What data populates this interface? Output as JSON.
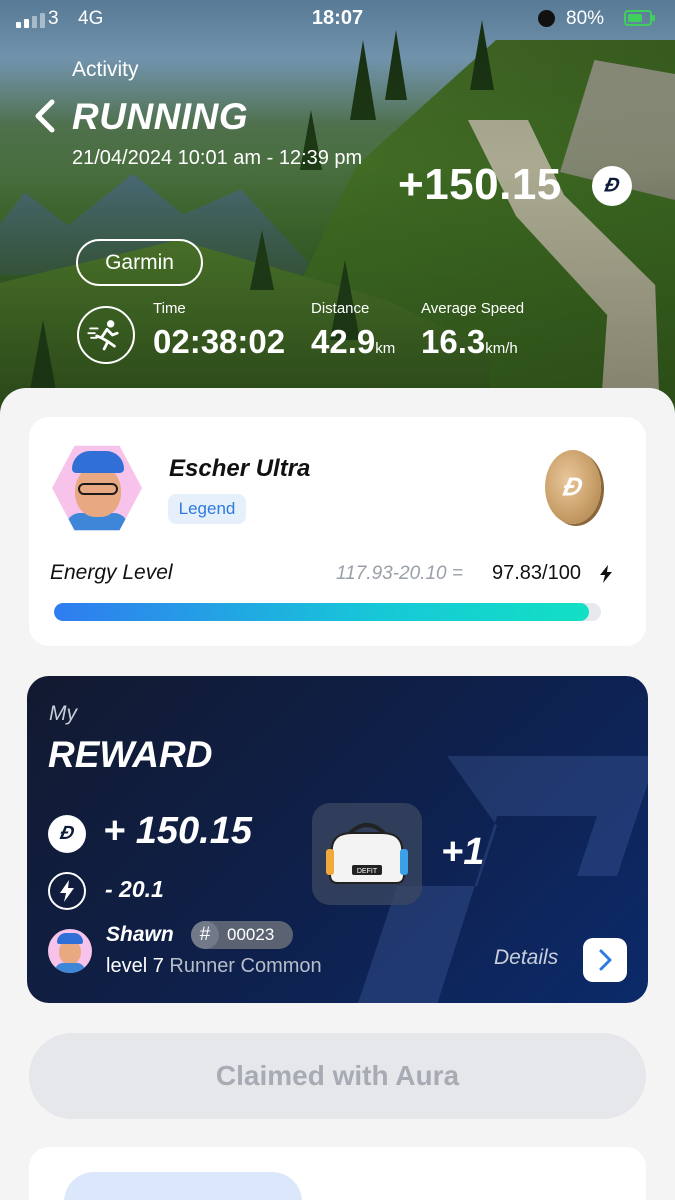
{
  "status_bar": {
    "carrier": "3",
    "network": "4G",
    "time": "18:07",
    "battery": "80%"
  },
  "header": {
    "eyebrow": "Activity",
    "title": "RUNNING",
    "date_range": "21/04/2024 10:01 am - 12:39 pm",
    "earned": "+150.15",
    "device": "Garmin"
  },
  "stats": [
    {
      "label": "Time",
      "value": "02:38:02",
      "unit": ""
    },
    {
      "label": "Distance",
      "value": "42.9",
      "unit": "km"
    },
    {
      "label": "Average Speed",
      "value": "16.3",
      "unit": "km/h"
    }
  ],
  "profile": {
    "name": "Escher Ultra",
    "tier": "Legend",
    "energy_label": "Energy Level",
    "energy_calc": "117.93-20.10 =",
    "energy_value": "97.83/100",
    "energy_fraction": 0.9783
  },
  "reward": {
    "eyebrow": "My",
    "title": "REWARD",
    "coins": "+ 150.15",
    "energy_spent": "- 20.1",
    "item_count": "+1",
    "bag_label": "DEFIT",
    "owner_name": "Shawn",
    "owner_id_symbol": "#",
    "owner_id": "00023",
    "owner_level": "level 7",
    "owner_class": "Runner Common",
    "details_label": "Details"
  },
  "claim": {
    "label": "Claimed with Aura"
  },
  "colors": {
    "accent_blue": "#2f7cf0",
    "accent_teal": "#12e0c4",
    "reward_bg": "#0f1f47",
    "tag_blue": "#2d7be0",
    "battery_green": "#3ecf5c"
  },
  "icons": [
    "back-chevron-icon",
    "coin-icon",
    "running-icon",
    "bolt-icon",
    "chevron-right-icon",
    "bag-icon",
    "alarm-icon",
    "battery-icon"
  ]
}
